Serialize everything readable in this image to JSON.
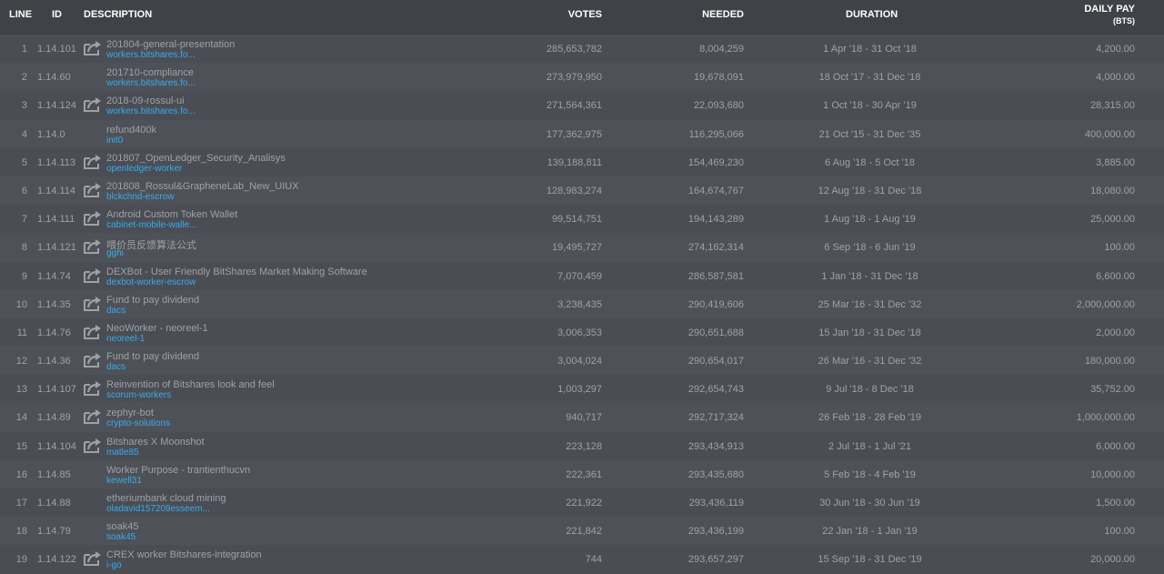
{
  "header": {
    "line": "LINE",
    "id": "ID",
    "description": "DESCRIPTION",
    "votes": "VOTES",
    "needed": "NEEDED",
    "duration": "DURATION",
    "daily_pay": "DAILY PAY",
    "daily_pay_unit": "(BTS)"
  },
  "rows": [
    {
      "line": "1",
      "id": "1.14.101",
      "icon": true,
      "title": "201804-general-presentation",
      "sub": "workers.bitshares.fo...",
      "votes": "285,653,782",
      "needed": "8,004,259",
      "duration": "1 Apr '18 - 31 Oct '18",
      "pay": "4,200.00"
    },
    {
      "line": "2",
      "id": "1.14.60",
      "icon": false,
      "title": "201710-compliance",
      "sub": "workers.bitshares.fo...",
      "votes": "273,979,950",
      "needed": "19,678,091",
      "duration": "18 Oct '17 - 31 Dec '18",
      "pay": "4,000.00"
    },
    {
      "line": "3",
      "id": "1.14.124",
      "icon": true,
      "title": "2018-09-rossul-ui",
      "sub": "workers.bitshares.fo...",
      "votes": "271,564,361",
      "needed": "22,093,680",
      "duration": "1 Oct '18 - 30 Apr '19",
      "pay": "28,315.00"
    },
    {
      "line": "4",
      "id": "1.14.0",
      "icon": false,
      "title": "refund400k",
      "sub": "init0",
      "votes": "177,362,975",
      "needed": "116,295,066",
      "duration": "21 Oct '15 - 31 Dec '35",
      "pay": "400,000.00"
    },
    {
      "line": "5",
      "id": "1.14.113",
      "icon": true,
      "title": "201807_OpenLedger_Security_Analisys",
      "sub": "openledger-worker",
      "votes": "139,188,811",
      "needed": "154,469,230",
      "duration": "6 Aug '18 - 5 Oct '18",
      "pay": "3,885.00"
    },
    {
      "line": "6",
      "id": "1.14.114",
      "icon": true,
      "title": "201808_Rossul&GrapheneLab_New_UIUX",
      "sub": "blckchnd-escrow",
      "votes": "128,983,274",
      "needed": "164,674,767",
      "duration": "12 Aug '18 - 31 Dec '18",
      "pay": "18,080.00"
    },
    {
      "line": "7",
      "id": "1.14.111",
      "icon": true,
      "title": "Android Custom Token Wallet",
      "sub": "cabinet-mobile-walle...",
      "votes": "99,514,751",
      "needed": "194,143,289",
      "duration": "1 Aug '18 - 1 Aug '19",
      "pay": "25,000.00"
    },
    {
      "line": "8",
      "id": "1.14.121",
      "icon": true,
      "title": "喂价员反馈算法公式",
      "sub": "gghi",
      "votes": "19,495,727",
      "needed": "274,162,314",
      "duration": "6 Sep '18 - 6 Jun '19",
      "pay": "100.00"
    },
    {
      "line": "9",
      "id": "1.14.74",
      "icon": true,
      "title": "DEXBot - User Friendly BitShares Market Making Software",
      "sub": "dexbot-worker-escrow",
      "votes": "7,070,459",
      "needed": "286,587,581",
      "duration": "1 Jan '18 - 31 Dec '18",
      "pay": "6,600.00"
    },
    {
      "line": "10",
      "id": "1.14.35",
      "icon": true,
      "title": "Fund to pay dividend",
      "sub": "dacs",
      "votes": "3,238,435",
      "needed": "290,419,606",
      "duration": "25 Mar '16 - 31 Dec '32",
      "pay": "2,000,000.00"
    },
    {
      "line": "11",
      "id": "1.14.76",
      "icon": true,
      "title": "NeoWorker - neoreel-1",
      "sub": "neoreel-1",
      "votes": "3,006,353",
      "needed": "290,651,688",
      "duration": "15 Jan '18 - 31 Dec '18",
      "pay": "2,000.00"
    },
    {
      "line": "12",
      "id": "1.14.36",
      "icon": true,
      "title": "Fund to pay dividend",
      "sub": "dacs",
      "votes": "3,004,024",
      "needed": "290,654,017",
      "duration": "26 Mar '16 - 31 Dec '32",
      "pay": "180,000.00"
    },
    {
      "line": "13",
      "id": "1.14.107",
      "icon": true,
      "title": "Reinvention of Bitshares look and feel",
      "sub": "scorum-workers",
      "votes": "1,003,297",
      "needed": "292,654,743",
      "duration": "9 Jul '18 - 8 Dec '18",
      "pay": "35,752.00"
    },
    {
      "line": "14",
      "id": "1.14.89",
      "icon": true,
      "title": "zephyr-bot",
      "sub": "crypto-solutions",
      "votes": "940,717",
      "needed": "292,717,324",
      "duration": "26 Feb '18 - 28 Feb '19",
      "pay": "1,000,000.00"
    },
    {
      "line": "15",
      "id": "1.14.104",
      "icon": true,
      "title": "Bitshares X Moonshot",
      "sub": "matle85",
      "votes": "223,128",
      "needed": "293,434,913",
      "duration": "2 Jul '18 - 1 Jul '21",
      "pay": "6,000.00"
    },
    {
      "line": "16",
      "id": "1.14.85",
      "icon": false,
      "title": "Worker Purpose - trantienthucvn",
      "sub": "kewell31",
      "votes": "222,361",
      "needed": "293,435,680",
      "duration": "5 Feb '18 - 4 Feb '19",
      "pay": "10,000.00"
    },
    {
      "line": "17",
      "id": "1.14.88",
      "icon": false,
      "title": "etheriumbank cloud mining",
      "sub": "oladavid157209esseem...",
      "votes": "221,922",
      "needed": "293,436,119",
      "duration": "30 Jun '18 - 30 Jun '19",
      "pay": "1,500.00"
    },
    {
      "line": "18",
      "id": "1.14.79",
      "icon": false,
      "title": "soak45",
      "sub": "soak45",
      "votes": "221,842",
      "needed": "293,436,199",
      "duration": "22 Jan '18 - 1 Jan '19",
      "pay": "100.00"
    },
    {
      "line": "19",
      "id": "1.14.122",
      "icon": true,
      "title": "CREX worker Bitshares-integration",
      "sub": "i-go",
      "votes": "744",
      "needed": "293,657,297",
      "duration": "15 Sep '18 - 31 Dec '19",
      "pay": "20,000.00"
    }
  ],
  "icon_name": "external-link-icon",
  "colors": {
    "background": "#4a4e54",
    "header_bg": "#3f4347",
    "text": "#9ea2a7",
    "link": "#3aa9ef"
  }
}
